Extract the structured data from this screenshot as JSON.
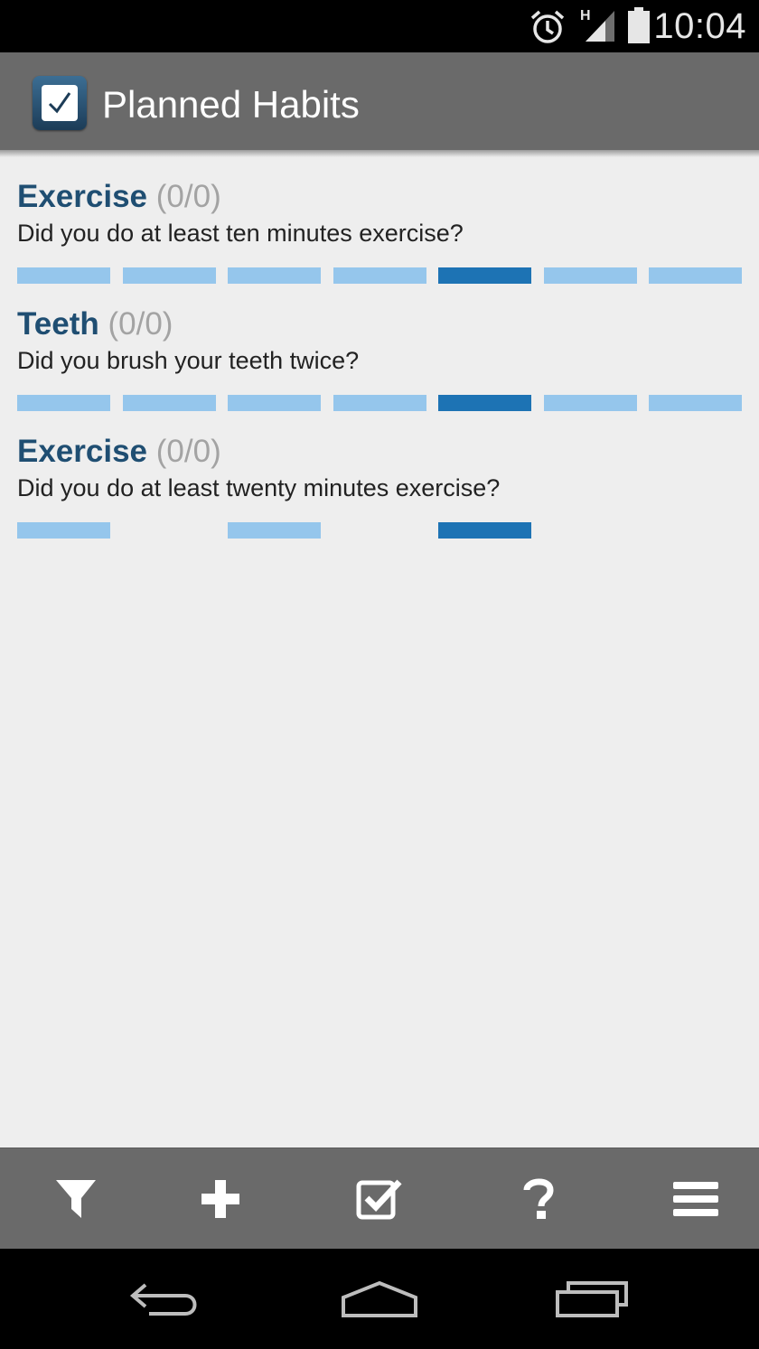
{
  "status_bar": {
    "time": "10:04",
    "network_label": "H",
    "icons": [
      "alarm-icon",
      "signal-icon",
      "battery-icon"
    ]
  },
  "app_bar": {
    "title": "Planned Habits",
    "icon": "checkbox-app-icon"
  },
  "habits": [
    {
      "name": "Exercise",
      "count": "(0/0)",
      "question": "Did you do at least ten minutes exercise?",
      "days": [
        "planned",
        "planned",
        "planned",
        "planned",
        "today",
        "planned",
        "planned"
      ]
    },
    {
      "name": "Teeth",
      "count": "(0/0)",
      "question": "Did you brush your teeth twice?",
      "days": [
        "planned",
        "planned",
        "planned",
        "planned",
        "today",
        "planned",
        "planned"
      ]
    },
    {
      "name": "Exercise",
      "count": "(0/0)",
      "question": "Did you do at least twenty minutes exercise?",
      "days": [
        "planned",
        "none",
        "planned",
        "none",
        "today",
        "none",
        "none"
      ]
    }
  ],
  "bottom_toolbar": {
    "buttons": [
      "filter-icon",
      "add-icon",
      "check-icon",
      "help-icon",
      "menu-icon"
    ]
  },
  "navigation_bar": {
    "buttons": [
      "back-icon",
      "home-icon",
      "recent-apps-icon"
    ]
  },
  "colors": {
    "planned_day": "#95c6ec",
    "today": "#1d73b4",
    "habit_title": "#1f4e72",
    "count": "#a3a3a3",
    "bar_background": "#6a6a6a"
  }
}
